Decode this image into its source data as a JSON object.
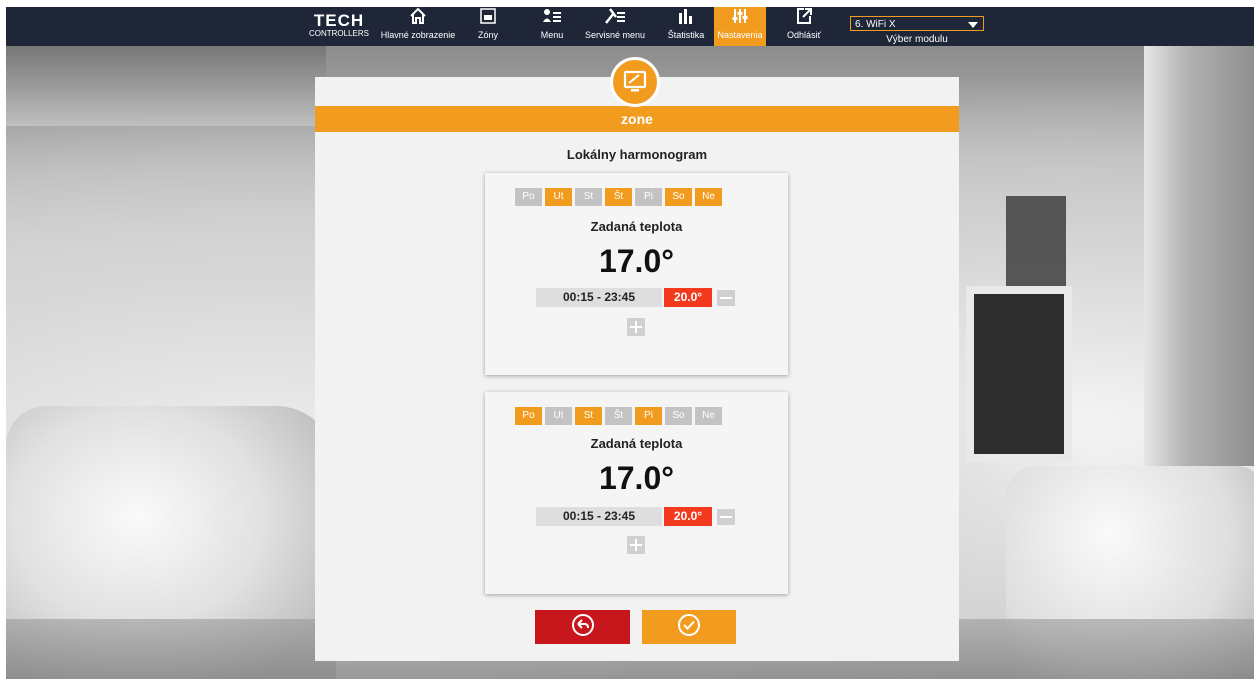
{
  "brand": {
    "line1": "TECH",
    "line2": "CONTROLLERS"
  },
  "nav": [
    {
      "label": "Hlavné zobrazenie",
      "icon": "home-icon"
    },
    {
      "label": "Zóny",
      "icon": "zones-icon"
    },
    {
      "label": "Menu",
      "icon": "menu-icon"
    },
    {
      "label": "Servisné menu",
      "icon": "service-menu-icon"
    },
    {
      "label": "Štatistika",
      "icon": "statistics-icon"
    },
    {
      "label": "Nastavenia",
      "icon": "settings-icon",
      "active": true
    },
    {
      "label": "Odhlásiť",
      "icon": "logout-icon"
    }
  ],
  "module": {
    "selected": "6. WiFi X",
    "caption": "Výber modulu"
  },
  "zone": {
    "title": "zone"
  },
  "schedule": {
    "title": "Lokálny harmonogram",
    "cards": [
      {
        "days": [
          {
            "label": "Po",
            "on": false
          },
          {
            "label": "Ut",
            "on": true
          },
          {
            "label": "St",
            "on": false
          },
          {
            "label": "Št",
            "on": true
          },
          {
            "label": "Pi",
            "on": false
          },
          {
            "label": "So",
            "on": true
          },
          {
            "label": "Ne",
            "on": true
          }
        ],
        "set_label": "Zadaná teplota",
        "set_temp": "17.0°",
        "interval": "00:15  -  23:45",
        "interval_temp": "20.0°"
      },
      {
        "days": [
          {
            "label": "Po",
            "on": true
          },
          {
            "label": "Ut",
            "on": false
          },
          {
            "label": "St",
            "on": true
          },
          {
            "label": "Št",
            "on": false
          },
          {
            "label": "Pi",
            "on": true
          },
          {
            "label": "So",
            "on": false
          },
          {
            "label": "Ne",
            "on": false
          }
        ],
        "set_label": "Zadaná teplota",
        "set_temp": "17.0°",
        "interval": "00:15  -  23:45",
        "interval_temp": "20.0°"
      }
    ]
  },
  "colors": {
    "accent": "#f29c1f",
    "nav_bg": "#1f2638",
    "danger": "#c8161d",
    "temp_red": "#f23a1e",
    "day_off": "#c3c3c3"
  }
}
